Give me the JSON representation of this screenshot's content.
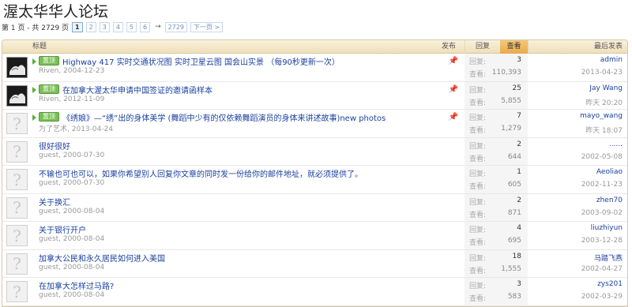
{
  "forum": {
    "title": "渥太华华人论坛"
  },
  "pager": {
    "info": "第 1 页 - 共 2729 页",
    "pages": [
      "1",
      "2",
      "3",
      "4",
      "5",
      "6"
    ],
    "arrow": "→",
    "last": "2729",
    "next": "下一页 >"
  },
  "headers": {
    "title": "标题",
    "post": "发布",
    "reply": "回复",
    "views": "查看",
    "last": "最后发表"
  },
  "labels": {
    "reply": "回复:",
    "views": "查看:"
  },
  "topics": [
    {
      "sticky_label": "置顶",
      "title": "Highway 417 实时交通状况图 实时卫星云图 国会山实景 （每90秒更新一次）",
      "author": "Riven",
      "date": "2004-12-23",
      "replies": "3",
      "views": "110,393",
      "last_user": "admin",
      "last_date": "2013-04-23",
      "avatar": "photo",
      "sticky": true
    },
    {
      "sticky_label": "置顶",
      "title": "在加拿大渥太华申请中国签证的邀请函样本",
      "author": "Riven",
      "date": "2012-11-09",
      "replies": "25",
      "views": "5,855",
      "last_user": "Jay Wang",
      "last_date": "昨天 20:20",
      "avatar": "photo",
      "sticky": true
    },
    {
      "sticky_label": "置顶",
      "title": "《绣娘》—“绣”出的身体美学 (舞蹈中少有的仅依赖舞蹈演员的身体来讲述故事)new photos",
      "author": "为了艺术",
      "date": "2013-04-24",
      "replies": "7",
      "views": "1,279",
      "last_user": "mayo_wang",
      "last_date": "昨天 18:07",
      "avatar": "default",
      "sticky": true
    },
    {
      "title": "很好很好",
      "author": "guest",
      "date": "2000-07-30",
      "replies": "2",
      "views": "644",
      "last_user": "......",
      "last_date": "2002-05-08",
      "avatar": "default",
      "sticky": false
    },
    {
      "title": "不输也可也可以，如果你希望别人回复你文章的同时发一份给你的邮件地址，就必须提供了。",
      "author": "guest",
      "date": "2000-07-30",
      "replies": "1",
      "views": "605",
      "last_user": "Aeoliao",
      "last_date": "2002-11-23",
      "avatar": "default",
      "sticky": false
    },
    {
      "title": "关于换汇",
      "author": "guest",
      "date": "2000-08-04",
      "replies": "2",
      "views": "871",
      "last_user": "zhen70",
      "last_date": "2003-09-02",
      "avatar": "default",
      "sticky": false
    },
    {
      "title": "关于银行开户",
      "author": "guest",
      "date": "2000-08-04",
      "replies": "4",
      "views": "695",
      "last_user": "liuzhiyun",
      "last_date": "2003-12-28",
      "avatar": "default",
      "sticky": false
    },
    {
      "title": "加拿大公民和永久居民如何进入美国",
      "author": "guest",
      "date": "2000-08-04",
      "replies": "18",
      "views": "1,555",
      "last_user": "马踏飞燕",
      "last_date": "2002-04-27",
      "avatar": "default",
      "sticky": false
    },
    {
      "title": "在加拿大怎样过马路?",
      "author": "guest",
      "date": "2000-08-04",
      "replies": "3",
      "views": "583",
      "last_user": "zys201",
      "last_date": "2002-03-29",
      "avatar": "default",
      "sticky": false
    }
  ]
}
